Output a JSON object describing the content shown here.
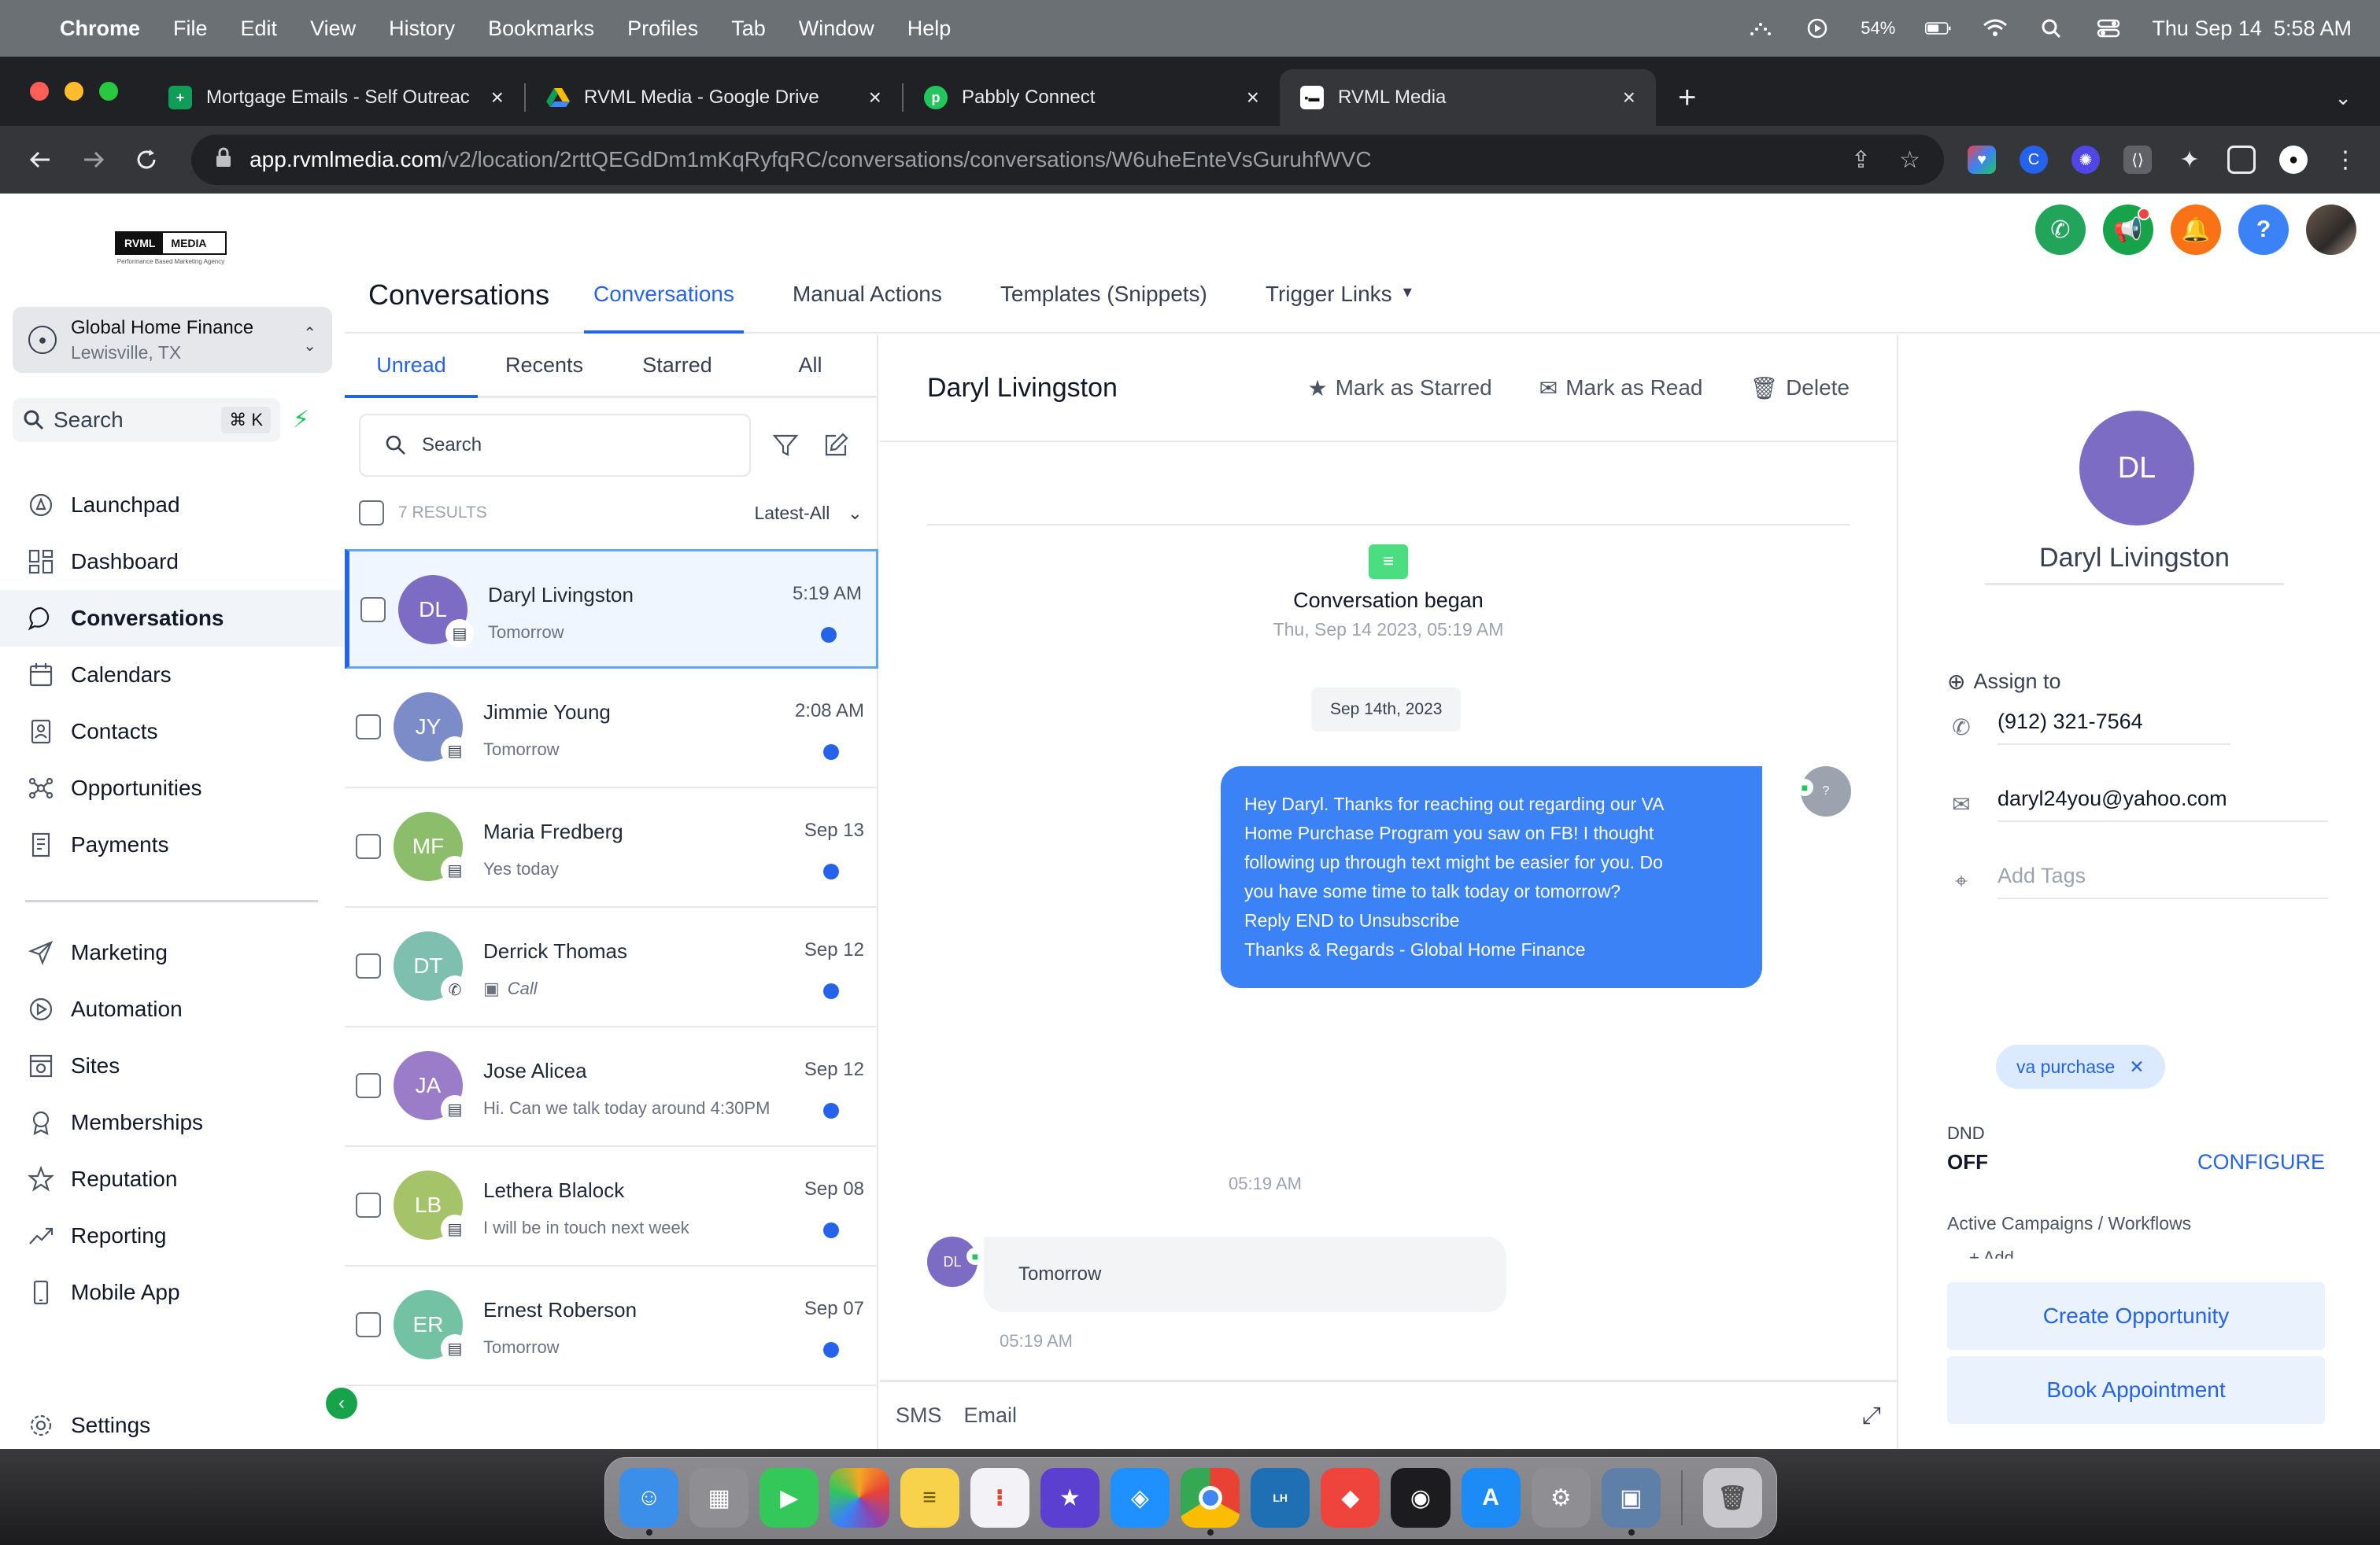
{
  "menubar": {
    "app": "Chrome",
    "items": [
      "File",
      "Edit",
      "View",
      "History",
      "Bookmarks",
      "Profiles",
      "Tab",
      "Window",
      "Help"
    ],
    "battery": "54%",
    "datetime": "Thu Sep 14  5:58 AM"
  },
  "browser": {
    "tabs": [
      {
        "title": "Mortgage Emails - Self Outreac",
        "icon_color": "#0f9d58"
      },
      {
        "title": "RVML Media - Google Drive",
        "icon_color": "#fbbc04"
      },
      {
        "title": "Pabbly Connect",
        "icon_color": "#22c55e"
      },
      {
        "title": "RVML Media",
        "icon_color": "#ffffff"
      }
    ],
    "url_host": "app.rvmlmedia.com",
    "url_path": "/v2/location/2rttQEGdDm1mKqRyfqRC/conversations/conversations/W6uheEnteVsGuruhfWVC"
  },
  "sidebar": {
    "logo_left": "RVML",
    "logo_right": "MEDIA",
    "logo_tag": "Performance Based Marketing Agency",
    "location_name": "Global Home Finance",
    "location_city": "Lewisville, TX",
    "search_label": "Search",
    "search_kbd": "⌘ K",
    "nav_primary": [
      {
        "label": "Launchpad",
        "icon": "rocket-icon"
      },
      {
        "label": "Dashboard",
        "icon": "dashboard-icon"
      },
      {
        "label": "Conversations",
        "icon": "chat-icon"
      },
      {
        "label": "Calendars",
        "icon": "calendar-icon"
      },
      {
        "label": "Contacts",
        "icon": "contacts-icon"
      },
      {
        "label": "Opportunities",
        "icon": "opportunities-icon"
      },
      {
        "label": "Payments",
        "icon": "payments-icon"
      }
    ],
    "nav_secondary": [
      {
        "label": "Marketing",
        "icon": "send-icon"
      },
      {
        "label": "Automation",
        "icon": "automation-icon"
      },
      {
        "label": "Sites",
        "icon": "sites-icon"
      },
      {
        "label": "Memberships",
        "icon": "award-icon"
      },
      {
        "label": "Reputation",
        "icon": "star-icon"
      },
      {
        "label": "Reporting",
        "icon": "trend-icon"
      },
      {
        "label": "Mobile App",
        "icon": "mobile-icon"
      }
    ],
    "settings_label": "Settings"
  },
  "header": {
    "title": "Conversations",
    "tabs": [
      "Conversations",
      "Manual Actions",
      "Templates (Snippets)",
      "Trigger Links"
    ],
    "action_colors": {
      "phone": "#22a55b",
      "announce": "#16a34a",
      "bell": "#f97316",
      "help": "#3b82f6"
    }
  },
  "list": {
    "tabs": [
      "Unread",
      "Recents",
      "Starred",
      "All"
    ],
    "search_placeholder": "Search",
    "results": "7 RESULTS",
    "sort": "Latest-All",
    "rows": [
      {
        "initials": "DL",
        "name": "Daryl Livingston",
        "preview": "Tomorrow",
        "time": "5:19 AM",
        "color": "#7c6cc4",
        "badge": "chat"
      },
      {
        "initials": "JY",
        "name": "Jimmie Young",
        "preview": "Tomorrow",
        "time": "2:08 AM",
        "color": "#7b8cc9",
        "badge": "chat"
      },
      {
        "initials": "MF",
        "name": "Maria Fredberg",
        "preview": "Yes today",
        "time": "Sep 13",
        "color": "#8cbd6a",
        "badge": "chat"
      },
      {
        "initials": "DT",
        "name": "Derrick Thomas",
        "preview": "Call",
        "time": "Sep 12",
        "color": "#7fbfb0",
        "badge": "phone"
      },
      {
        "initials": "JA",
        "name": "Jose Alicea",
        "preview": "Hi. Can we talk today around 4:30PM",
        "time": "Sep 12",
        "color": "#9b7cc9",
        "badge": "chat"
      },
      {
        "initials": "LB",
        "name": "Lethera Blalock",
        "preview": "I will be in touch next week",
        "time": "Sep 08",
        "color": "#a5c46a",
        "badge": "chat"
      },
      {
        "initials": "ER",
        "name": "Ernest Roberson",
        "preview": "Tomorrow",
        "time": "Sep 07",
        "color": "#72c2a3",
        "badge": "chat"
      }
    ]
  },
  "conversation": {
    "name": "Daryl Livingston",
    "actions": [
      "Mark as Starred",
      "Mark as Read",
      "Delete"
    ],
    "began_label": "Conversation began",
    "began_date": "Thu, Sep 14 2023, 05:19 AM",
    "date_pill": "Sep 14th, 2023",
    "outbound_lines": [
      "Hey Daryl. Thanks for reaching out regarding our VA",
      "Home Purchase Program you saw on FB! I thought",
      "following up through text might be easier for you. Do",
      "you have some time to talk today or tomorrow?",
      "Reply END to Unsubscribe",
      "Thanks & Regards - Global Home Finance"
    ],
    "outbound_avatar": "?",
    "outbound_time": "05:19 AM",
    "inbound_initials": "DL",
    "inbound_text": "Tomorrow",
    "inbound_time": "05:19 AM",
    "composer_tabs": [
      "SMS",
      "Email"
    ]
  },
  "contact": {
    "initials": "DL",
    "name": "Daryl Livingston",
    "assign_label": "Assign to",
    "phone": "(912) 321-7564",
    "email": "daryl24you@yahoo.com",
    "tags_placeholder": "Add Tags",
    "tag": "va purchase",
    "dnd_label": "DND",
    "dnd_value": "OFF",
    "configure": "CONFIGURE",
    "campaigns_label": "Active Campaigns / Workflows",
    "campaigns_add": "+ Add",
    "create_opportunity": "Create Opportunity",
    "book_appointment": "Book Appointment"
  },
  "dock": {
    "apps": [
      {
        "name": "Finder",
        "color": "#3b8fe8"
      },
      {
        "name": "Launchpad",
        "color": "#8e8e93"
      },
      {
        "name": "FaceTime",
        "color": "#34c759"
      },
      {
        "name": "Photos",
        "color": "#f5a623"
      },
      {
        "name": "Notes",
        "color": "#f7d24a"
      },
      {
        "name": "Reminders",
        "color": "#f2f2f7"
      },
      {
        "name": "iMovie",
        "color": "#5b3fd1"
      },
      {
        "name": "Safari",
        "color": "#1e90ff"
      },
      {
        "name": "Chrome",
        "color": "#e94235"
      },
      {
        "name": "Linked Helper",
        "color": "#1f6fb4"
      },
      {
        "name": "AnyDesk",
        "color": "#ef443b"
      },
      {
        "name": "OBS",
        "color": "#1c1c1e"
      },
      {
        "name": "App Store",
        "color": "#1c8bf5"
      },
      {
        "name": "System Settings",
        "color": "#8e8e93"
      },
      {
        "name": "Preview",
        "color": "#5e7fa8"
      },
      {
        "name": "Trash",
        "color": "#c7c7cc"
      }
    ]
  }
}
